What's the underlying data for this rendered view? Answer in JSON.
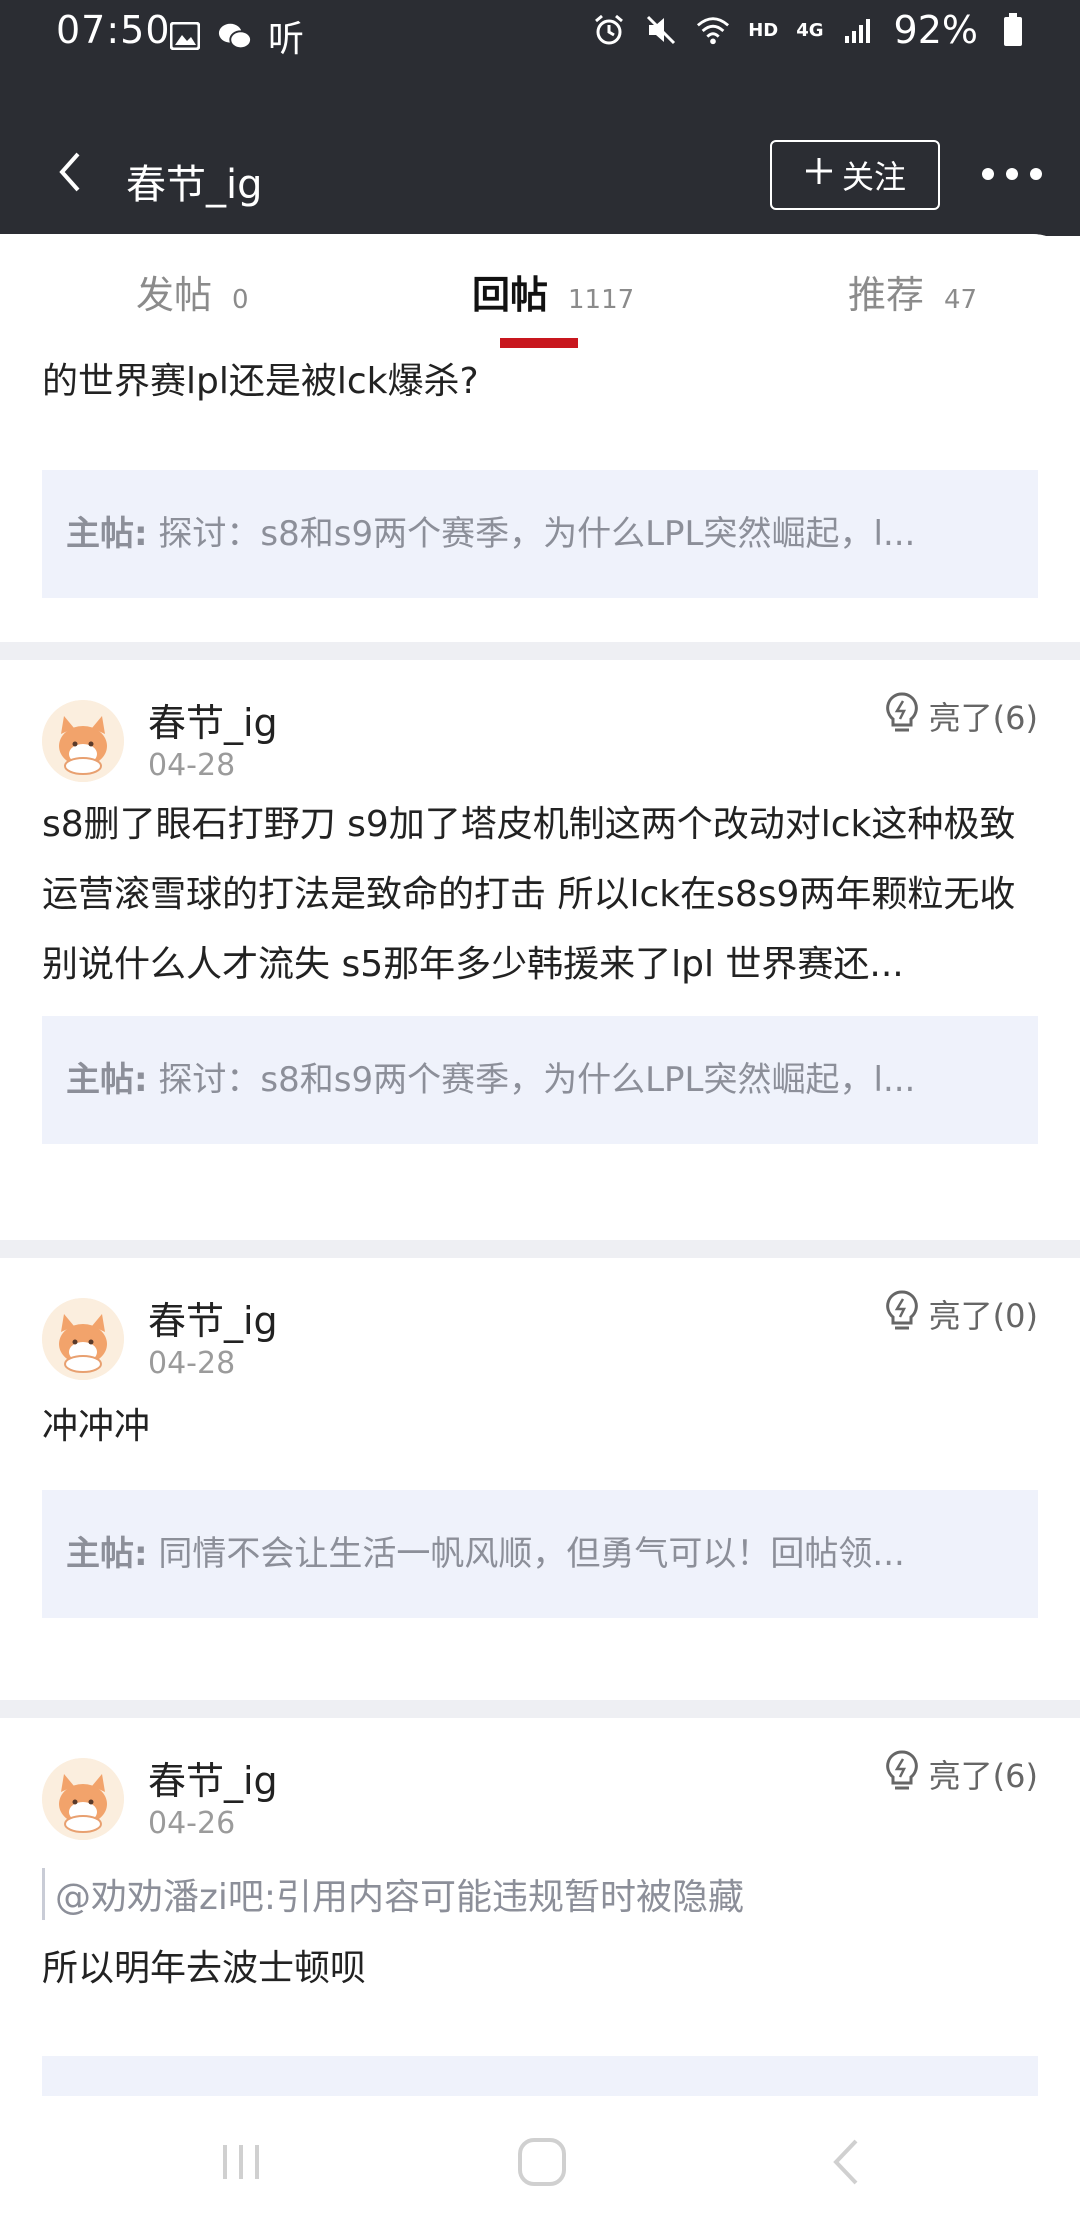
{
  "status": {
    "time": "07:50",
    "listen_label": "听",
    "hd_label": "HD",
    "network_label": "4G",
    "battery": "92%"
  },
  "header": {
    "title": "春节_ig",
    "follow_label": "关注"
  },
  "tabs": [
    {
      "label": "发帖",
      "count": "0"
    },
    {
      "label": "回帖",
      "count": "1117"
    },
    {
      "label": "推荐",
      "count": "47"
    }
  ],
  "partial_post": {
    "text": "的世界赛lpl还是被lck爆杀?",
    "quote_label": "主帖:",
    "quote_text": " 探讨：s8和s9两个赛季，为什么LPL突然崛起，l..."
  },
  "posts": [
    {
      "author": "春节_ig",
      "date": "04-28",
      "light": "亮了(6)",
      "body": "s8删了眼石打野刀 s9加了塔皮机制这两个改动对lck这种极致运营滚雪球的打法是致命的打击 所以lck在s8s9两年颗粒无收别说什么人才流失 s5那年多少韩援来了lpl 世界赛还...",
      "quote_label": "主帖:",
      "quote_text": " 探讨：s8和s9两个赛季，为什么LPL突然崛起，l..."
    },
    {
      "author": "春节_ig",
      "date": "04-28",
      "light": "亮了(0)",
      "body": "冲冲冲",
      "quote_label": "主帖:",
      "quote_text": " 同情不会让生活一帆风顺，但勇气可以！回帖领..."
    },
    {
      "author": "春节_ig",
      "date": "04-26",
      "light": "亮了(6)",
      "reference": "@劝劝潘zi吧:引用内容可能违规暂时被隐藏",
      "body": "所以明年去波士顿呗"
    }
  ]
}
